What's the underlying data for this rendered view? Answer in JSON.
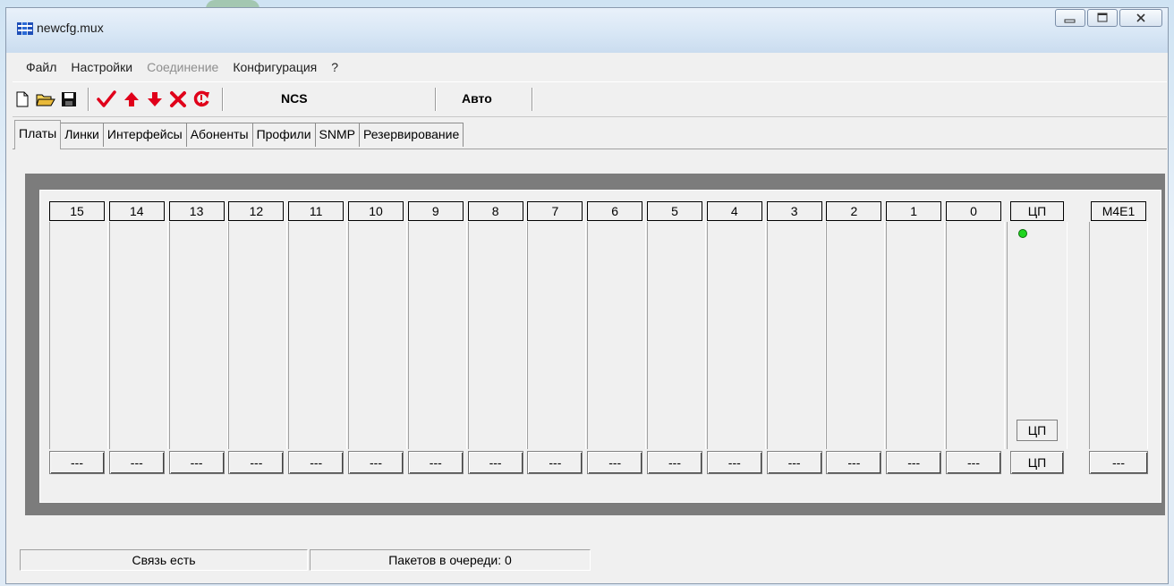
{
  "window": {
    "title": "newcfg.mux"
  },
  "window_controls": [
    "minimize",
    "maximize",
    "close"
  ],
  "menu": [
    {
      "label": "Файл",
      "enabled": true
    },
    {
      "label": "Настройки",
      "enabled": true
    },
    {
      "label": "Соединение",
      "enabled": false
    },
    {
      "label": "Конфигурация",
      "enabled": true
    },
    {
      "label": "?",
      "enabled": true
    }
  ],
  "toolbar": {
    "icons": [
      "new-file-icon",
      "open-folder-icon",
      "save-icon",
      "checkmark-icon",
      "arrow-up-icon",
      "arrow-down-icon",
      "delete-icon",
      "refresh-icon"
    ],
    "ncs_label": "NCS",
    "auto_label": "Авто",
    "colors": {
      "accent": "#e0001a"
    }
  },
  "tabs": [
    {
      "label": "Платы",
      "active": true
    },
    {
      "label": "Линки",
      "active": false
    },
    {
      "label": "Интерфейсы",
      "active": false
    },
    {
      "label": "Абоненты",
      "active": false
    },
    {
      "label": "Профили",
      "active": false
    },
    {
      "label": "SNMP",
      "active": false
    },
    {
      "label": "Резервирование",
      "active": false
    }
  ],
  "slots": [
    {
      "header": "15",
      "footer": "---"
    },
    {
      "header": "14",
      "footer": "---"
    },
    {
      "header": "13",
      "footer": "---"
    },
    {
      "header": "12",
      "footer": "---"
    },
    {
      "header": "11",
      "footer": "---"
    },
    {
      "header": "10",
      "footer": "---"
    },
    {
      "header": "9",
      "footer": "---"
    },
    {
      "header": "8",
      "footer": "---"
    },
    {
      "header": "7",
      "footer": "---"
    },
    {
      "header": "6",
      "footer": "---"
    },
    {
      "header": "5",
      "footer": "---"
    },
    {
      "header": "4",
      "footer": "---"
    },
    {
      "header": "3",
      "footer": "---"
    },
    {
      "header": "2",
      "footer": "---"
    },
    {
      "header": "1",
      "footer": "---"
    },
    {
      "header": "0",
      "footer": "---"
    }
  ],
  "cpu_slot": {
    "header": "ЦП",
    "card_label": "ЦП",
    "footer": "ЦП",
    "led_color": "#1fd51f"
  },
  "extra_slot": {
    "header": "M4E1",
    "footer": "---"
  },
  "status": {
    "connection": "Связь есть",
    "queue": "Пакетов в очереди: 0"
  }
}
